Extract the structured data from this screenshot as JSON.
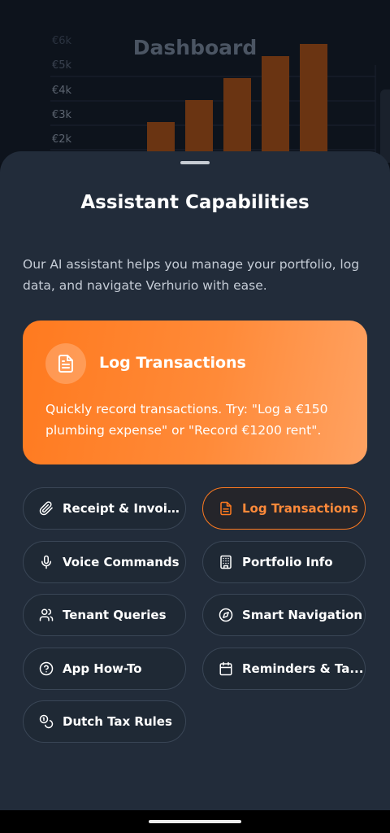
{
  "background": {
    "title": "Dashboard",
    "y_ticks": [
      "€6k",
      "€5k",
      "€4k",
      "€3k",
      "€2k"
    ],
    "bar_values": [
      1.8,
      2.7,
      3.6,
      4.5,
      5.0
    ]
  },
  "sheet": {
    "title": "Assistant Capabilities",
    "intro": "Our AI assistant helps you manage your portfolio, log data, and navigate Verhurio with ease.",
    "feature": {
      "title": "Log Transactions",
      "description": "Quickly record transactions. Try: \"Log a €150 plumbing expense\" or \"Record €1200 rent\".",
      "icon": "document-icon",
      "gradient": [
        "#ff7a1f",
        "#ffa262"
      ]
    },
    "chips": [
      {
        "label": "Receipt & Invoic...",
        "icon": "paperclip-icon",
        "active": false
      },
      {
        "label": "Log Transactions",
        "icon": "document-icon",
        "active": true
      },
      {
        "label": "Voice Commands",
        "icon": "microphone-icon",
        "active": false
      },
      {
        "label": "Portfolio Info",
        "icon": "building-icon",
        "active": false
      },
      {
        "label": "Tenant Queries",
        "icon": "users-icon",
        "active": false
      },
      {
        "label": "Smart Navigation",
        "icon": "compass-icon",
        "active": false
      },
      {
        "label": "App How-To",
        "icon": "help-circle-icon",
        "active": false
      },
      {
        "label": "Reminders & Ta...",
        "icon": "calendar-icon",
        "active": false
      },
      {
        "label": "Dutch Tax Rules",
        "icon": "coins-icon",
        "active": false
      }
    ]
  },
  "colors": {
    "accent": "#ff7a1f",
    "sheet_bg": "#222c3a",
    "chip_border": "#3a4656"
  }
}
